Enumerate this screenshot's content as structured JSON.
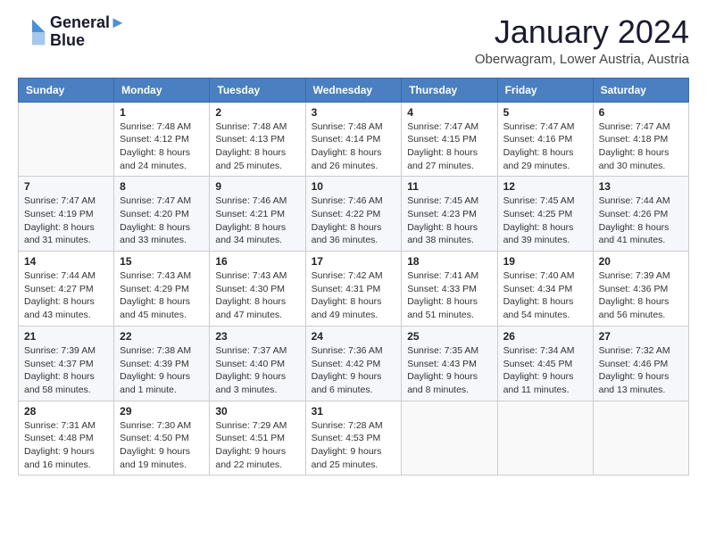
{
  "header": {
    "logo_line1": "General",
    "logo_line2": "Blue",
    "month_year": "January 2024",
    "location": "Oberwagram, Lower Austria, Austria"
  },
  "days_of_week": [
    "Sunday",
    "Monday",
    "Tuesday",
    "Wednesday",
    "Thursday",
    "Friday",
    "Saturday"
  ],
  "weeks": [
    [
      {
        "day": "",
        "sunrise": "",
        "sunset": "",
        "daylight": ""
      },
      {
        "day": "1",
        "sunrise": "Sunrise: 7:48 AM",
        "sunset": "Sunset: 4:12 PM",
        "daylight": "Daylight: 8 hours and 24 minutes."
      },
      {
        "day": "2",
        "sunrise": "Sunrise: 7:48 AM",
        "sunset": "Sunset: 4:13 PM",
        "daylight": "Daylight: 8 hours and 25 minutes."
      },
      {
        "day": "3",
        "sunrise": "Sunrise: 7:48 AM",
        "sunset": "Sunset: 4:14 PM",
        "daylight": "Daylight: 8 hours and 26 minutes."
      },
      {
        "day": "4",
        "sunrise": "Sunrise: 7:47 AM",
        "sunset": "Sunset: 4:15 PM",
        "daylight": "Daylight: 8 hours and 27 minutes."
      },
      {
        "day": "5",
        "sunrise": "Sunrise: 7:47 AM",
        "sunset": "Sunset: 4:16 PM",
        "daylight": "Daylight: 8 hours and 29 minutes."
      },
      {
        "day": "6",
        "sunrise": "Sunrise: 7:47 AM",
        "sunset": "Sunset: 4:18 PM",
        "daylight": "Daylight: 8 hours and 30 minutes."
      }
    ],
    [
      {
        "day": "7",
        "sunrise": "Sunrise: 7:47 AM",
        "sunset": "Sunset: 4:19 PM",
        "daylight": "Daylight: 8 hours and 31 minutes."
      },
      {
        "day": "8",
        "sunrise": "Sunrise: 7:47 AM",
        "sunset": "Sunset: 4:20 PM",
        "daylight": "Daylight: 8 hours and 33 minutes."
      },
      {
        "day": "9",
        "sunrise": "Sunrise: 7:46 AM",
        "sunset": "Sunset: 4:21 PM",
        "daylight": "Daylight: 8 hours and 34 minutes."
      },
      {
        "day": "10",
        "sunrise": "Sunrise: 7:46 AM",
        "sunset": "Sunset: 4:22 PM",
        "daylight": "Daylight: 8 hours and 36 minutes."
      },
      {
        "day": "11",
        "sunrise": "Sunrise: 7:45 AM",
        "sunset": "Sunset: 4:23 PM",
        "daylight": "Daylight: 8 hours and 38 minutes."
      },
      {
        "day": "12",
        "sunrise": "Sunrise: 7:45 AM",
        "sunset": "Sunset: 4:25 PM",
        "daylight": "Daylight: 8 hours and 39 minutes."
      },
      {
        "day": "13",
        "sunrise": "Sunrise: 7:44 AM",
        "sunset": "Sunset: 4:26 PM",
        "daylight": "Daylight: 8 hours and 41 minutes."
      }
    ],
    [
      {
        "day": "14",
        "sunrise": "Sunrise: 7:44 AM",
        "sunset": "Sunset: 4:27 PM",
        "daylight": "Daylight: 8 hours and 43 minutes."
      },
      {
        "day": "15",
        "sunrise": "Sunrise: 7:43 AM",
        "sunset": "Sunset: 4:29 PM",
        "daylight": "Daylight: 8 hours and 45 minutes."
      },
      {
        "day": "16",
        "sunrise": "Sunrise: 7:43 AM",
        "sunset": "Sunset: 4:30 PM",
        "daylight": "Daylight: 8 hours and 47 minutes."
      },
      {
        "day": "17",
        "sunrise": "Sunrise: 7:42 AM",
        "sunset": "Sunset: 4:31 PM",
        "daylight": "Daylight: 8 hours and 49 minutes."
      },
      {
        "day": "18",
        "sunrise": "Sunrise: 7:41 AM",
        "sunset": "Sunset: 4:33 PM",
        "daylight": "Daylight: 8 hours and 51 minutes."
      },
      {
        "day": "19",
        "sunrise": "Sunrise: 7:40 AM",
        "sunset": "Sunset: 4:34 PM",
        "daylight": "Daylight: 8 hours and 54 minutes."
      },
      {
        "day": "20",
        "sunrise": "Sunrise: 7:39 AM",
        "sunset": "Sunset: 4:36 PM",
        "daylight": "Daylight: 8 hours and 56 minutes."
      }
    ],
    [
      {
        "day": "21",
        "sunrise": "Sunrise: 7:39 AM",
        "sunset": "Sunset: 4:37 PM",
        "daylight": "Daylight: 8 hours and 58 minutes."
      },
      {
        "day": "22",
        "sunrise": "Sunrise: 7:38 AM",
        "sunset": "Sunset: 4:39 PM",
        "daylight": "Daylight: 9 hours and 1 minute."
      },
      {
        "day": "23",
        "sunrise": "Sunrise: 7:37 AM",
        "sunset": "Sunset: 4:40 PM",
        "daylight": "Daylight: 9 hours and 3 minutes."
      },
      {
        "day": "24",
        "sunrise": "Sunrise: 7:36 AM",
        "sunset": "Sunset: 4:42 PM",
        "daylight": "Daylight: 9 hours and 6 minutes."
      },
      {
        "day": "25",
        "sunrise": "Sunrise: 7:35 AM",
        "sunset": "Sunset: 4:43 PM",
        "daylight": "Daylight: 9 hours and 8 minutes."
      },
      {
        "day": "26",
        "sunrise": "Sunrise: 7:34 AM",
        "sunset": "Sunset: 4:45 PM",
        "daylight": "Daylight: 9 hours and 11 minutes."
      },
      {
        "day": "27",
        "sunrise": "Sunrise: 7:32 AM",
        "sunset": "Sunset: 4:46 PM",
        "daylight": "Daylight: 9 hours and 13 minutes."
      }
    ],
    [
      {
        "day": "28",
        "sunrise": "Sunrise: 7:31 AM",
        "sunset": "Sunset: 4:48 PM",
        "daylight": "Daylight: 9 hours and 16 minutes."
      },
      {
        "day": "29",
        "sunrise": "Sunrise: 7:30 AM",
        "sunset": "Sunset: 4:50 PM",
        "daylight": "Daylight: 9 hours and 19 minutes."
      },
      {
        "day": "30",
        "sunrise": "Sunrise: 7:29 AM",
        "sunset": "Sunset: 4:51 PM",
        "daylight": "Daylight: 9 hours and 22 minutes."
      },
      {
        "day": "31",
        "sunrise": "Sunrise: 7:28 AM",
        "sunset": "Sunset: 4:53 PM",
        "daylight": "Daylight: 9 hours and 25 minutes."
      },
      {
        "day": "",
        "sunrise": "",
        "sunset": "",
        "daylight": ""
      },
      {
        "day": "",
        "sunrise": "",
        "sunset": "",
        "daylight": ""
      },
      {
        "day": "",
        "sunrise": "",
        "sunset": "",
        "daylight": ""
      }
    ]
  ]
}
